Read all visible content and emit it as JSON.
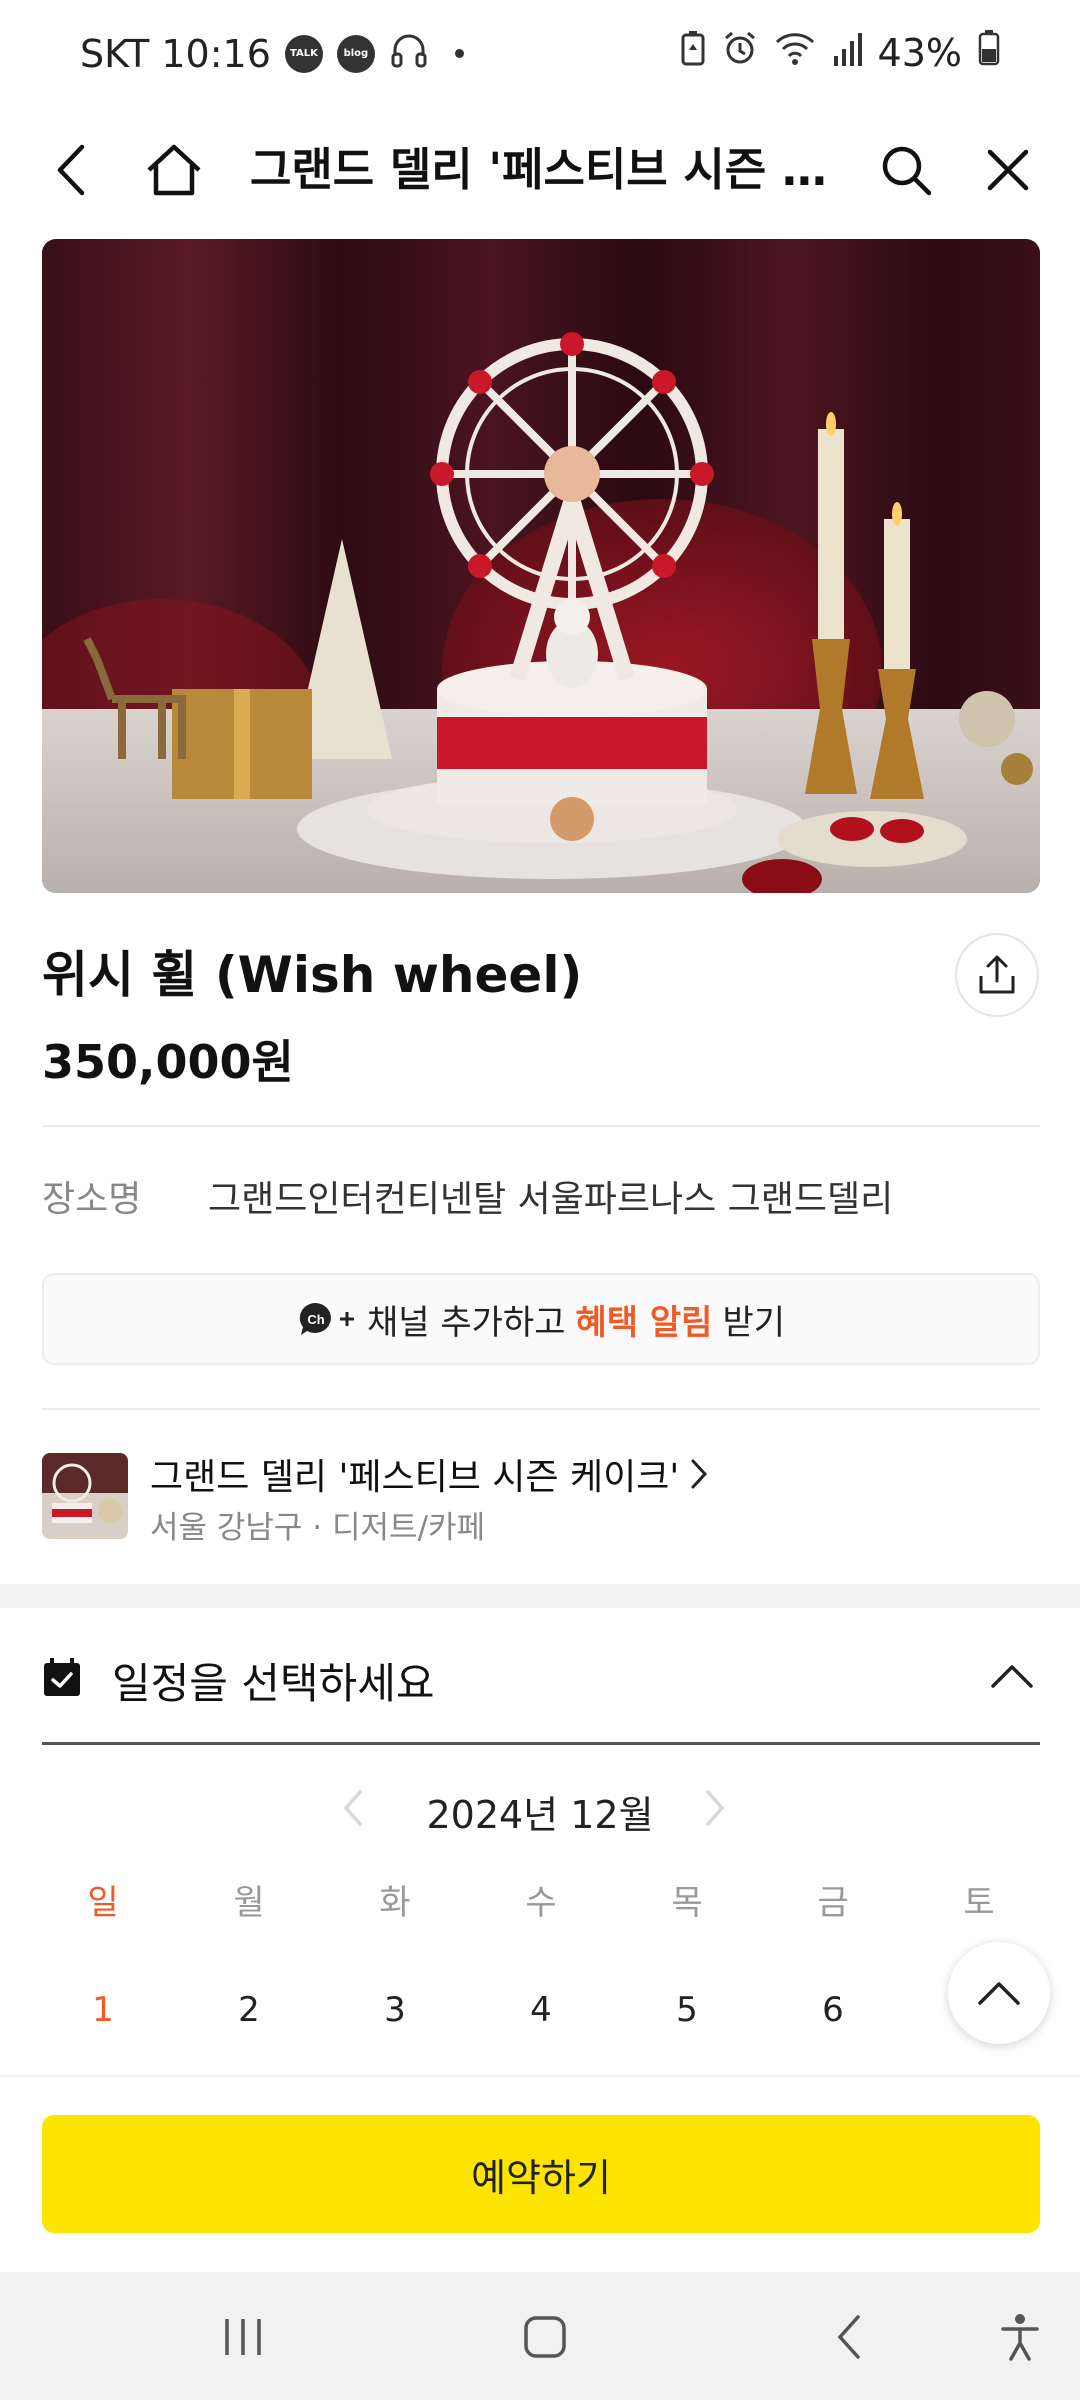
{
  "status_bar": {
    "carrier_time": "SKT 10:16",
    "app_icons": [
      "talk-icon",
      "blog-icon",
      "headphones-icon"
    ],
    "talk_label": "TALK",
    "blog_label": "blog",
    "battery": "43%"
  },
  "nav": {
    "title": "그랜드 델리 '페스티브 시즌 케..."
  },
  "product": {
    "title": "위시 휠 (Wish wheel)",
    "price": "350,000원"
  },
  "place": {
    "label": "장소명",
    "value": "그랜드인터컨티넨탈 서울파르나스 그랜드델리"
  },
  "channel": {
    "prefix": "채널 추가하고",
    "highlight": "혜택 알림",
    "suffix": "받기",
    "icon_text": "Ch",
    "accent_color": "#f05a24"
  },
  "store": {
    "name": "그랜드 델리 '페스티브 시즌 케이크'",
    "meta": "서울 강남구 · 디저트/카페"
  },
  "schedule": {
    "title": "일정을 선택하세요",
    "month": "2024년 12월",
    "weekdays": [
      "일",
      "월",
      "화",
      "수",
      "목",
      "금",
      "토"
    ],
    "days": [
      "1",
      "2",
      "3",
      "4",
      "5",
      "6"
    ]
  },
  "reserve": {
    "label": "예약하기",
    "color": "#fee500"
  }
}
